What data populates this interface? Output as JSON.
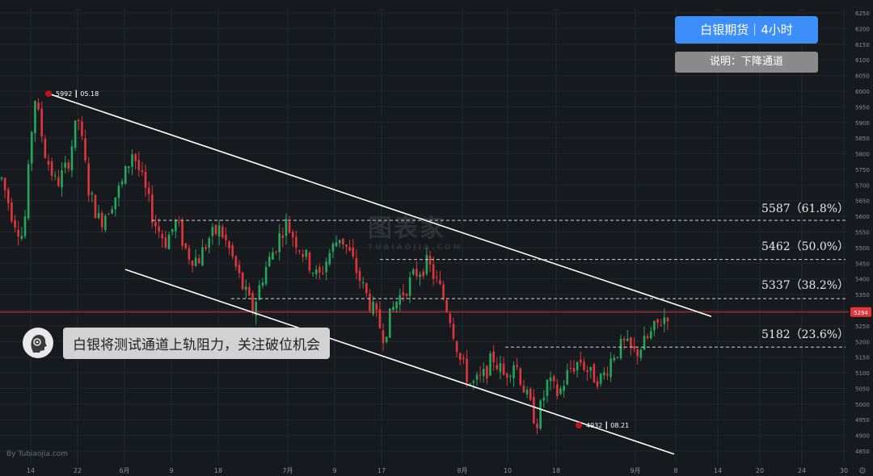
{
  "header": {
    "title": "白银期货｜4小时",
    "note": "说明：下降通道"
  },
  "callout": {
    "text": "白银将测试通道上轨阻力，关注破位机会"
  },
  "fib_levels": [
    {
      "label": "5587（61.8%）",
      "value": 5587
    },
    {
      "label": "5462（50.0%）",
      "value": 5462
    },
    {
      "label": "5337（38.2%）",
      "value": 5337
    },
    {
      "label": "5182（23.6%）",
      "value": 5182
    }
  ],
  "watermark": {
    "main": "图表家",
    "sub": "TUBIAOJIA.COM"
  },
  "brand": "By Tubiaojia.com",
  "colors": {
    "up": "#26a65b",
    "down": "#e0353b",
    "current": "#e0353b",
    "pivot": "#c0101e",
    "channel": "#ffffff",
    "grid": "#23282e",
    "axis_text": "#8b9097"
  },
  "chart_data": {
    "type": "candlestick",
    "ylim": [
      4800,
      6300
    ],
    "y_ticks": [
      4850,
      4900,
      4950,
      5000,
      5050,
      5100,
      5150,
      5200,
      5250,
      5300,
      5350,
      5400,
      5450,
      5500,
      5550,
      5600,
      5650,
      5700,
      5750,
      5800,
      5850,
      5900,
      5950,
      6000,
      6050,
      6100,
      6150,
      6200,
      6250
    ],
    "x_ticks": [
      "14",
      "22",
      "6月",
      "9",
      "18",
      "7月",
      "9",
      "17",
      "8月",
      "10",
      "18",
      "9月",
      "8",
      "14",
      "20",
      "24",
      "30"
    ],
    "current_price": 5294,
    "pivots": [
      {
        "value": 5992,
        "date": "05.18",
        "label": "5992 ┃ 05.18"
      },
      {
        "value": 4932,
        "date": "08.21",
        "label": "4932 ┃ 08.21"
      }
    ],
    "channel": {
      "upper": [
        5992,
        5280
      ],
      "lower": [
        5430,
        4840
      ]
    },
    "ohlc_path": [
      5720,
      5600,
      5530,
      5990,
      5800,
      5700,
      5760,
      5920,
      5680,
      5580,
      5640,
      5700,
      5810,
      5700,
      5580,
      5520,
      5580,
      5480,
      5460,
      5530,
      5560,
      5480,
      5380,
      5300,
      5420,
      5500,
      5580,
      5520,
      5460,
      5400,
      5480,
      5540,
      5470,
      5380,
      5300,
      5220,
      5320,
      5370,
      5420,
      5450,
      5380,
      5290,
      5140,
      5060,
      5080,
      5150,
      5090,
      5140,
      5030,
      4940,
      5070,
      5030,
      5110,
      5140,
      5090,
      5080,
      5160,
      5190,
      5160,
      5200,
      5250,
      5290
    ]
  }
}
